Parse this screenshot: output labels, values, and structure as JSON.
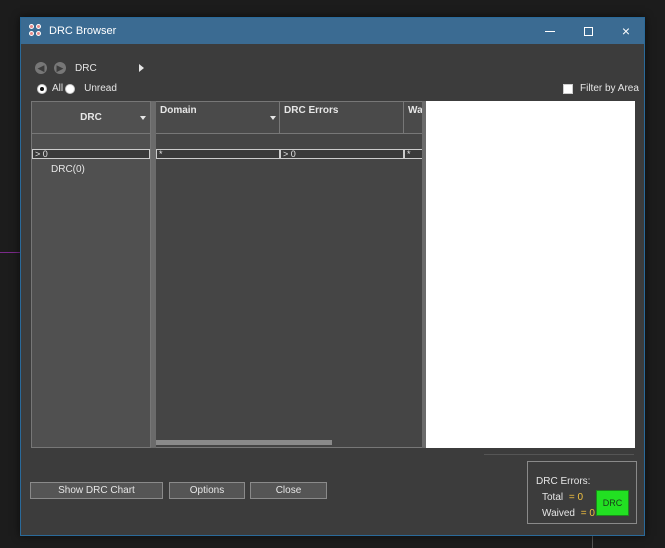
{
  "window": {
    "title": "DRC Browser",
    "icon": "app-icon",
    "controls": {
      "minimize": "minimize-icon",
      "maximize": "maximize-icon",
      "close": "×"
    }
  },
  "nav": {
    "back_icon": "arrow-left-icon",
    "forward_icon": "arrow-right-icon",
    "location": "DRC"
  },
  "view_filter": {
    "all_label": "All",
    "unread_label": "Unread",
    "selected": "All",
    "filter_by_area_label": "Filter by Area",
    "filter_by_area_checked": false
  },
  "tree": {
    "header": "DRC",
    "filter": "> 0",
    "items": [
      "DRC(0)"
    ]
  },
  "grid": {
    "columns": [
      {
        "label": "Domain",
        "filter": "*"
      },
      {
        "label": "DRC Errors",
        "filter": "> 0"
      },
      {
        "label": "Wa",
        "filter": "*"
      }
    ]
  },
  "buttons": {
    "show_chart": "Show DRC Chart",
    "options": "Options",
    "close": "Close"
  },
  "stats": {
    "title": "DRC Errors:",
    "total_label": "Total",
    "total_value": "= 0",
    "waived_label": "Waived",
    "waived_value": "= 0",
    "badge": "DRC",
    "badge_color": "#22e022",
    "value_color": "#f0c040"
  }
}
